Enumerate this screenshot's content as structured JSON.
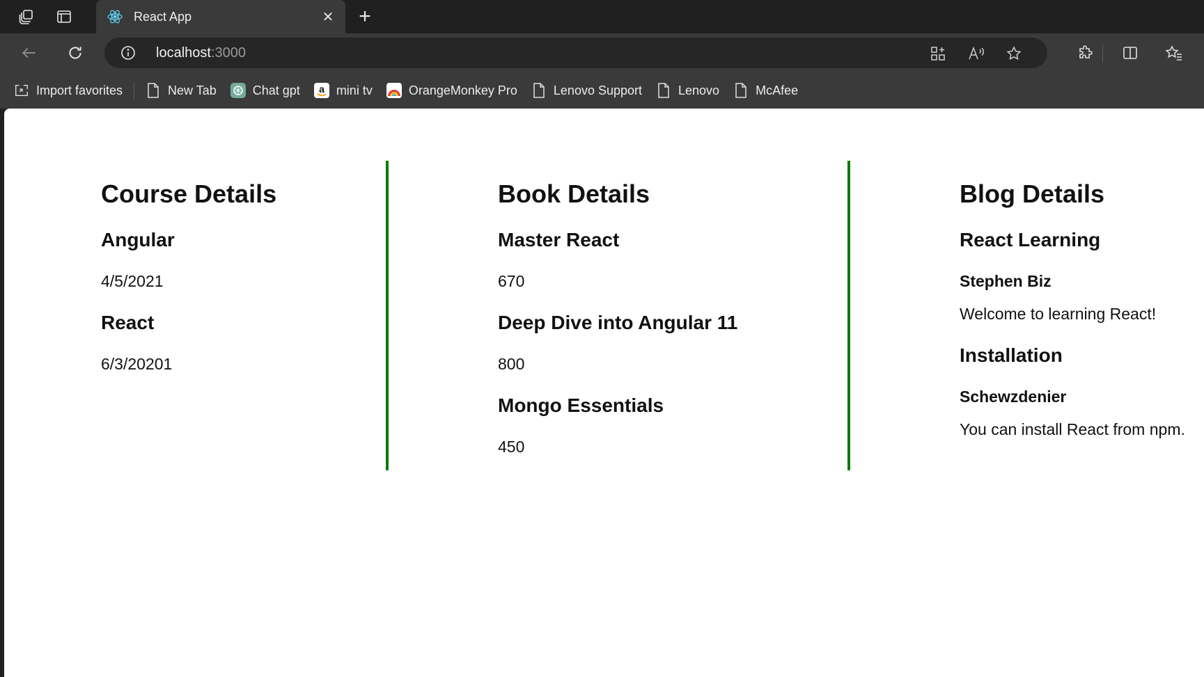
{
  "browser": {
    "tab": {
      "title": "React App",
      "favicon": "react-atom-icon"
    },
    "address": {
      "host": "localhost",
      "port": ":3000"
    },
    "bookmarks": [
      {
        "label": "Import favorites",
        "icon": "import-favorites-icon"
      },
      {
        "label": "New Tab",
        "icon": "page-icon"
      },
      {
        "label": "Chat gpt",
        "icon": "chatgpt-icon"
      },
      {
        "label": "mini tv",
        "icon": "amazon-icon"
      },
      {
        "label": "OrangeMonkey Pro",
        "icon": "orangemonkey-icon"
      },
      {
        "label": "Lenovo Support",
        "icon": "page-icon"
      },
      {
        "label": "Lenovo",
        "icon": "page-icon"
      },
      {
        "label": "McAfee",
        "icon": "page-icon"
      }
    ]
  },
  "page": {
    "course": {
      "heading": "Course Details",
      "items": [
        {
          "name": "Angular",
          "date": "4/5/2021"
        },
        {
          "name": "React",
          "date": "6/3/20201"
        }
      ]
    },
    "book": {
      "heading": "Book Details",
      "items": [
        {
          "name": "Master React",
          "price": "670"
        },
        {
          "name": "Deep Dive into Angular 11",
          "price": "800"
        },
        {
          "name": "Mongo Essentials",
          "price": "450"
        }
      ]
    },
    "blog": {
      "heading": "Blog Details",
      "items": [
        {
          "title": "React Learning",
          "author": "Stephen Biz",
          "body": "Welcome to learning React!"
        },
        {
          "title": "Installation",
          "author": "Schewzdenier",
          "body": "You can install React from npm."
        }
      ]
    }
  },
  "colors": {
    "divider": "#0a7d0a",
    "chrome": "#3a3a3a",
    "titlebar": "#202020"
  }
}
